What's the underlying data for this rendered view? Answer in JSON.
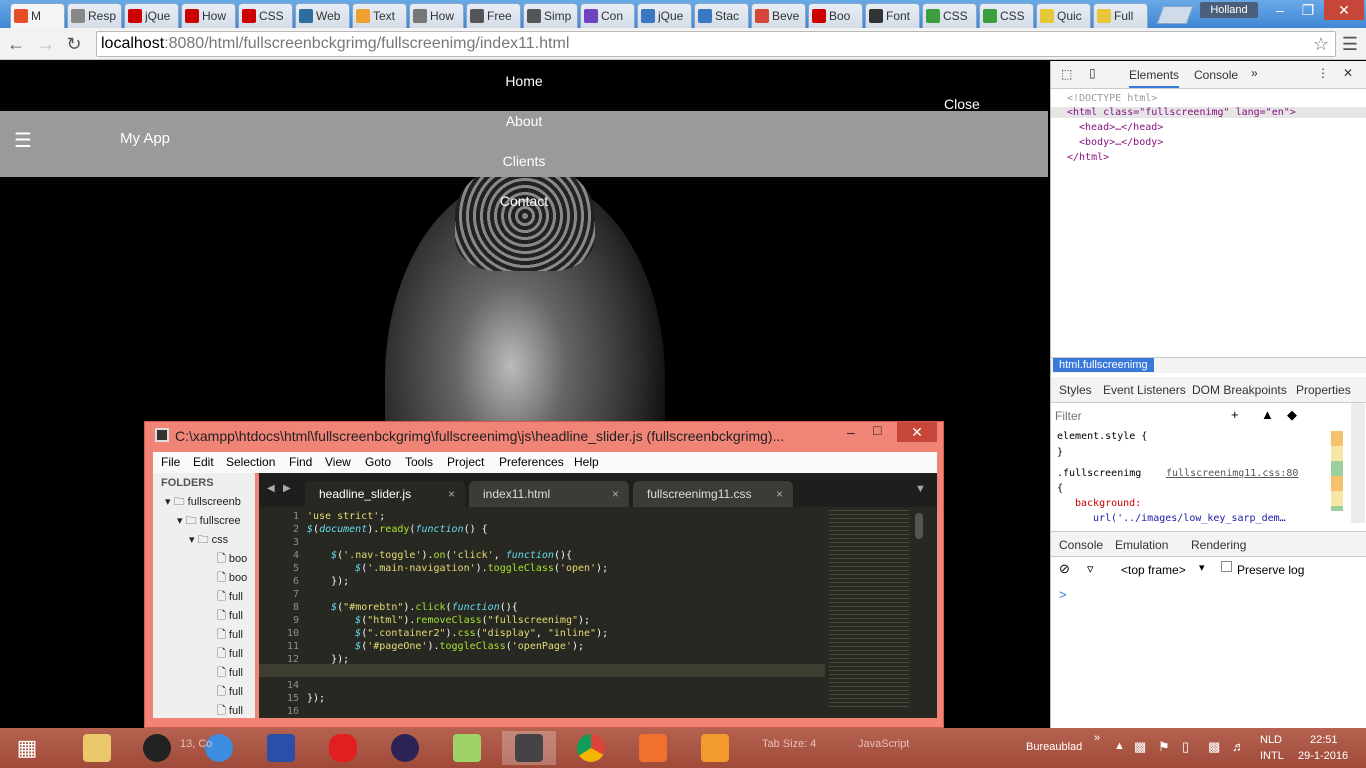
{
  "browser": {
    "tabs": [
      {
        "label": "M",
        "color": "#e44d26"
      },
      {
        "label": "Resp",
        "color": "#888888"
      },
      {
        "label": "jQue",
        "color": "#cc0000"
      },
      {
        "label": "How",
        "color": "#cc0000"
      },
      {
        "label": "CSS",
        "color": "#cc0000"
      },
      {
        "label": "Web",
        "color": "#2d6e9e"
      },
      {
        "label": "Text",
        "color": "#f0a030"
      },
      {
        "label": "How",
        "color": "#777777"
      },
      {
        "label": "Free",
        "color": "#555555"
      },
      {
        "label": "Simp",
        "color": "#555555"
      },
      {
        "label": "Con",
        "color": "#6f42c1"
      },
      {
        "label": "jQue",
        "color": "#3b78c2"
      },
      {
        "label": "Stac",
        "color": "#3b78c2"
      },
      {
        "label": "Beve",
        "color": "#d44638"
      },
      {
        "label": "Boo",
        "color": "#cc0000"
      },
      {
        "label": "Font",
        "color": "#333333"
      },
      {
        "label": "CSS",
        "color": "#3c9e3c"
      },
      {
        "label": "CSS",
        "color": "#3c9e3c"
      },
      {
        "label": "Quic",
        "color": "#e8c63a"
      },
      {
        "label": "Full",
        "color": "#e8c63a"
      }
    ],
    "user": "Holland",
    "url_host": "localhost",
    "url_path": ":8080/html/fullscreenbckgrimg/fullscreenimg/index11.html"
  },
  "page": {
    "app_title": "My App",
    "nav": [
      "Home",
      "About",
      "Clients",
      "Contact"
    ],
    "close": "Close"
  },
  "devtools": {
    "tabs": [
      "Elements",
      "Console"
    ],
    "dom": {
      "doctype": "<!DOCTYPE html>",
      "html_open": "<html class=\"fullscreenimg\" lang=\"en\">",
      "head": "<head>…</head>",
      "body": "<body>…</body>",
      "html_close": "</html>"
    },
    "breadcrumb": "html.fullscreenimg",
    "styles_tabs": [
      "Styles",
      "Event Listeners",
      "DOM Breakpoints",
      "Properties"
    ],
    "filter_placeholder": "Filter",
    "element_style": "element.style {",
    "close_brace": "}",
    "rule_selector": ".fullscreenimg",
    "rule_source": "fullscreenimg11.css:80",
    "rule_open": "{",
    "rule_prop": "background:",
    "rule_value": "url('../images/low_key_sarp_dem…",
    "drawer_tabs": [
      "Console",
      "Emulation",
      "Rendering"
    ],
    "frame": "<top frame>",
    "preserve_log": "Preserve log",
    "prompt": ">"
  },
  "sublime": {
    "title": "C:\\xampp\\htdocs\\html\\fullscreenbckgrimg\\fullscreenimg\\js\\headline_slider.js (fullscreenbckgrimg)...",
    "menu": [
      "File",
      "Edit",
      "Selection",
      "Find",
      "View",
      "Goto",
      "Tools",
      "Project",
      "Preferences",
      "Help"
    ],
    "folders_label": "FOLDERS",
    "tree": [
      "fullscreenb",
      "fullscree",
      "css",
      "boo",
      "boo",
      "full",
      "full",
      "full",
      "full",
      "full",
      "full",
      "full"
    ],
    "tabs": [
      "headline_slider.js",
      "index11.html",
      "fullscreenimg11.css"
    ],
    "line_numbers": [
      "1",
      "2",
      "3",
      "4",
      "5",
      "6",
      "7",
      "8",
      "9",
      "10",
      "11",
      "12",
      "13",
      "14",
      "15",
      "16"
    ]
  },
  "taskbar": {
    "status_left": "13, Co",
    "status_tab": "Tab Size: 4",
    "status_syntax": "JavaScript",
    "desktop_label": "Bureaublad",
    "lang_top": "NLD",
    "lang_bottom": "INTL",
    "time": "22:51",
    "date": "29-1-2016"
  }
}
